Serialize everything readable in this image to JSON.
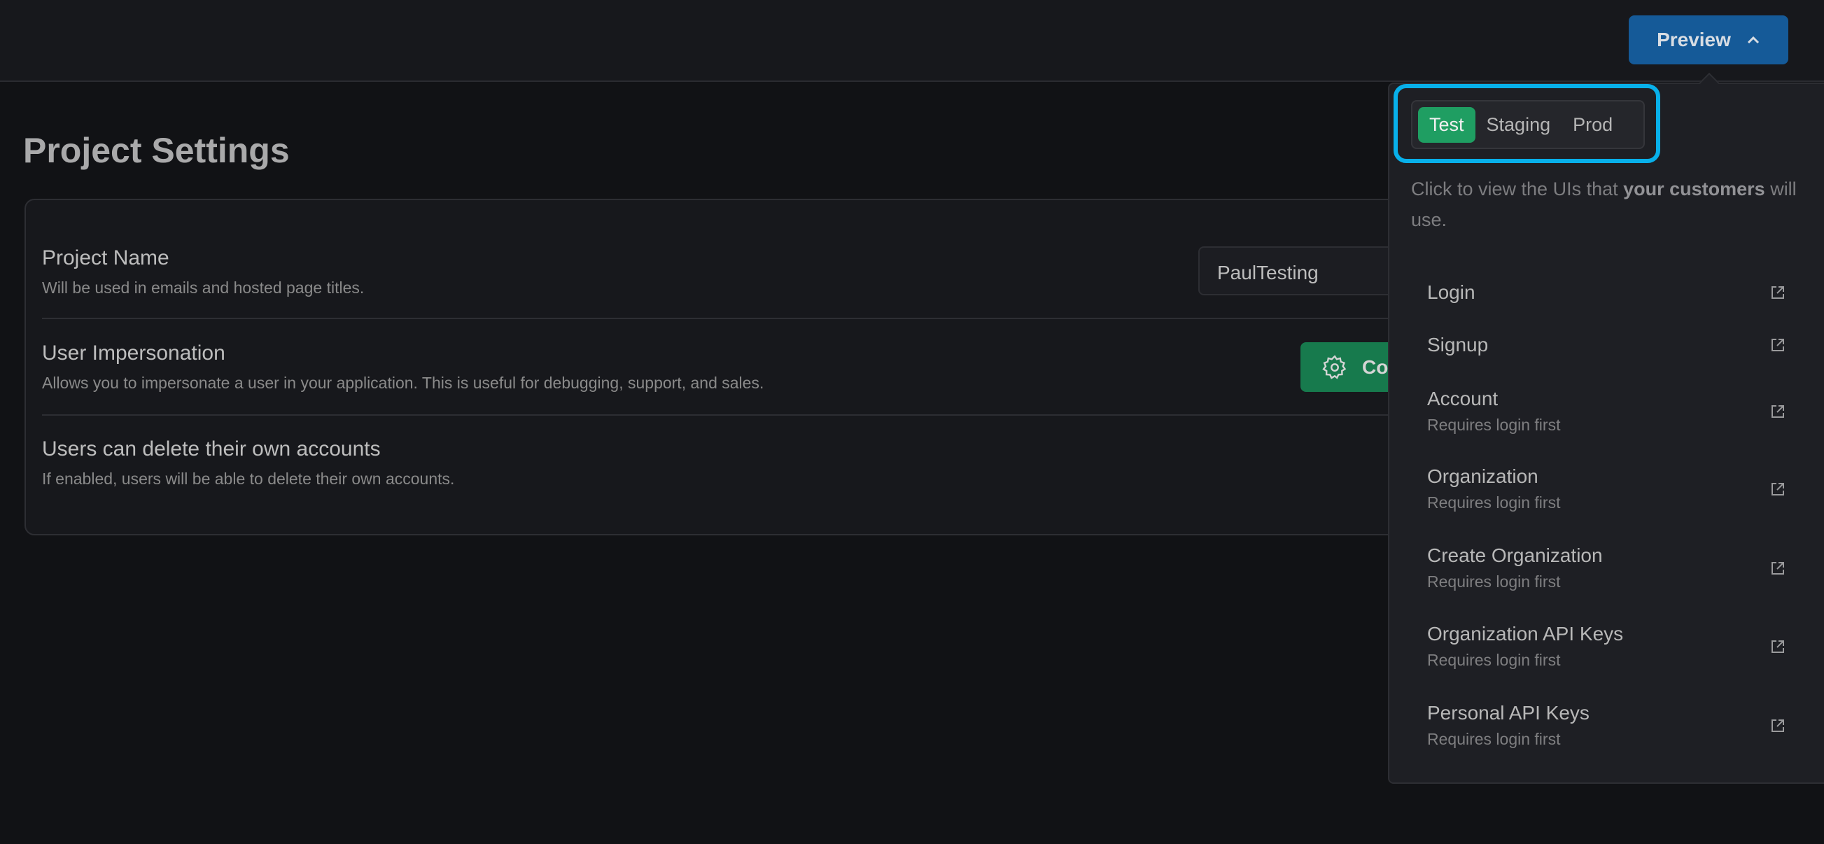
{
  "header": {
    "preview_label": "Preview"
  },
  "page": {
    "title": "Project Settings"
  },
  "settings": [
    {
      "label": "Project Name",
      "description": "Will be used in emails and hosted page titles.",
      "value": "PaulTesting"
    },
    {
      "label": "User Impersonation",
      "description": "Allows you to impersonate a user in your application. This is useful for debugging, support, and sales.",
      "button": "Co"
    },
    {
      "label": "Users can delete their own accounts",
      "description": "If enabled, users will be able to delete their own accounts."
    }
  ],
  "popover": {
    "environments": [
      "Test",
      "Staging",
      "Prod"
    ],
    "selected": "Test",
    "text_before": "Click to view the UIs that ",
    "text_bold": "your customers",
    "text_after": " will use.",
    "items": [
      {
        "label": "Login"
      },
      {
        "label": "Signup"
      },
      {
        "label": "Account",
        "sub": "Requires login first"
      },
      {
        "label": "Organization",
        "sub": "Requires login first"
      },
      {
        "label": "Create Organization",
        "sub": "Requires login first"
      },
      {
        "label": "Organization API Keys",
        "sub": "Requires login first"
      },
      {
        "label": "Personal API Keys",
        "sub": "Requires login first"
      }
    ]
  },
  "colors": {
    "accent": "#155a98",
    "active": "#1f9e62",
    "highlight": "#08b0ea"
  }
}
